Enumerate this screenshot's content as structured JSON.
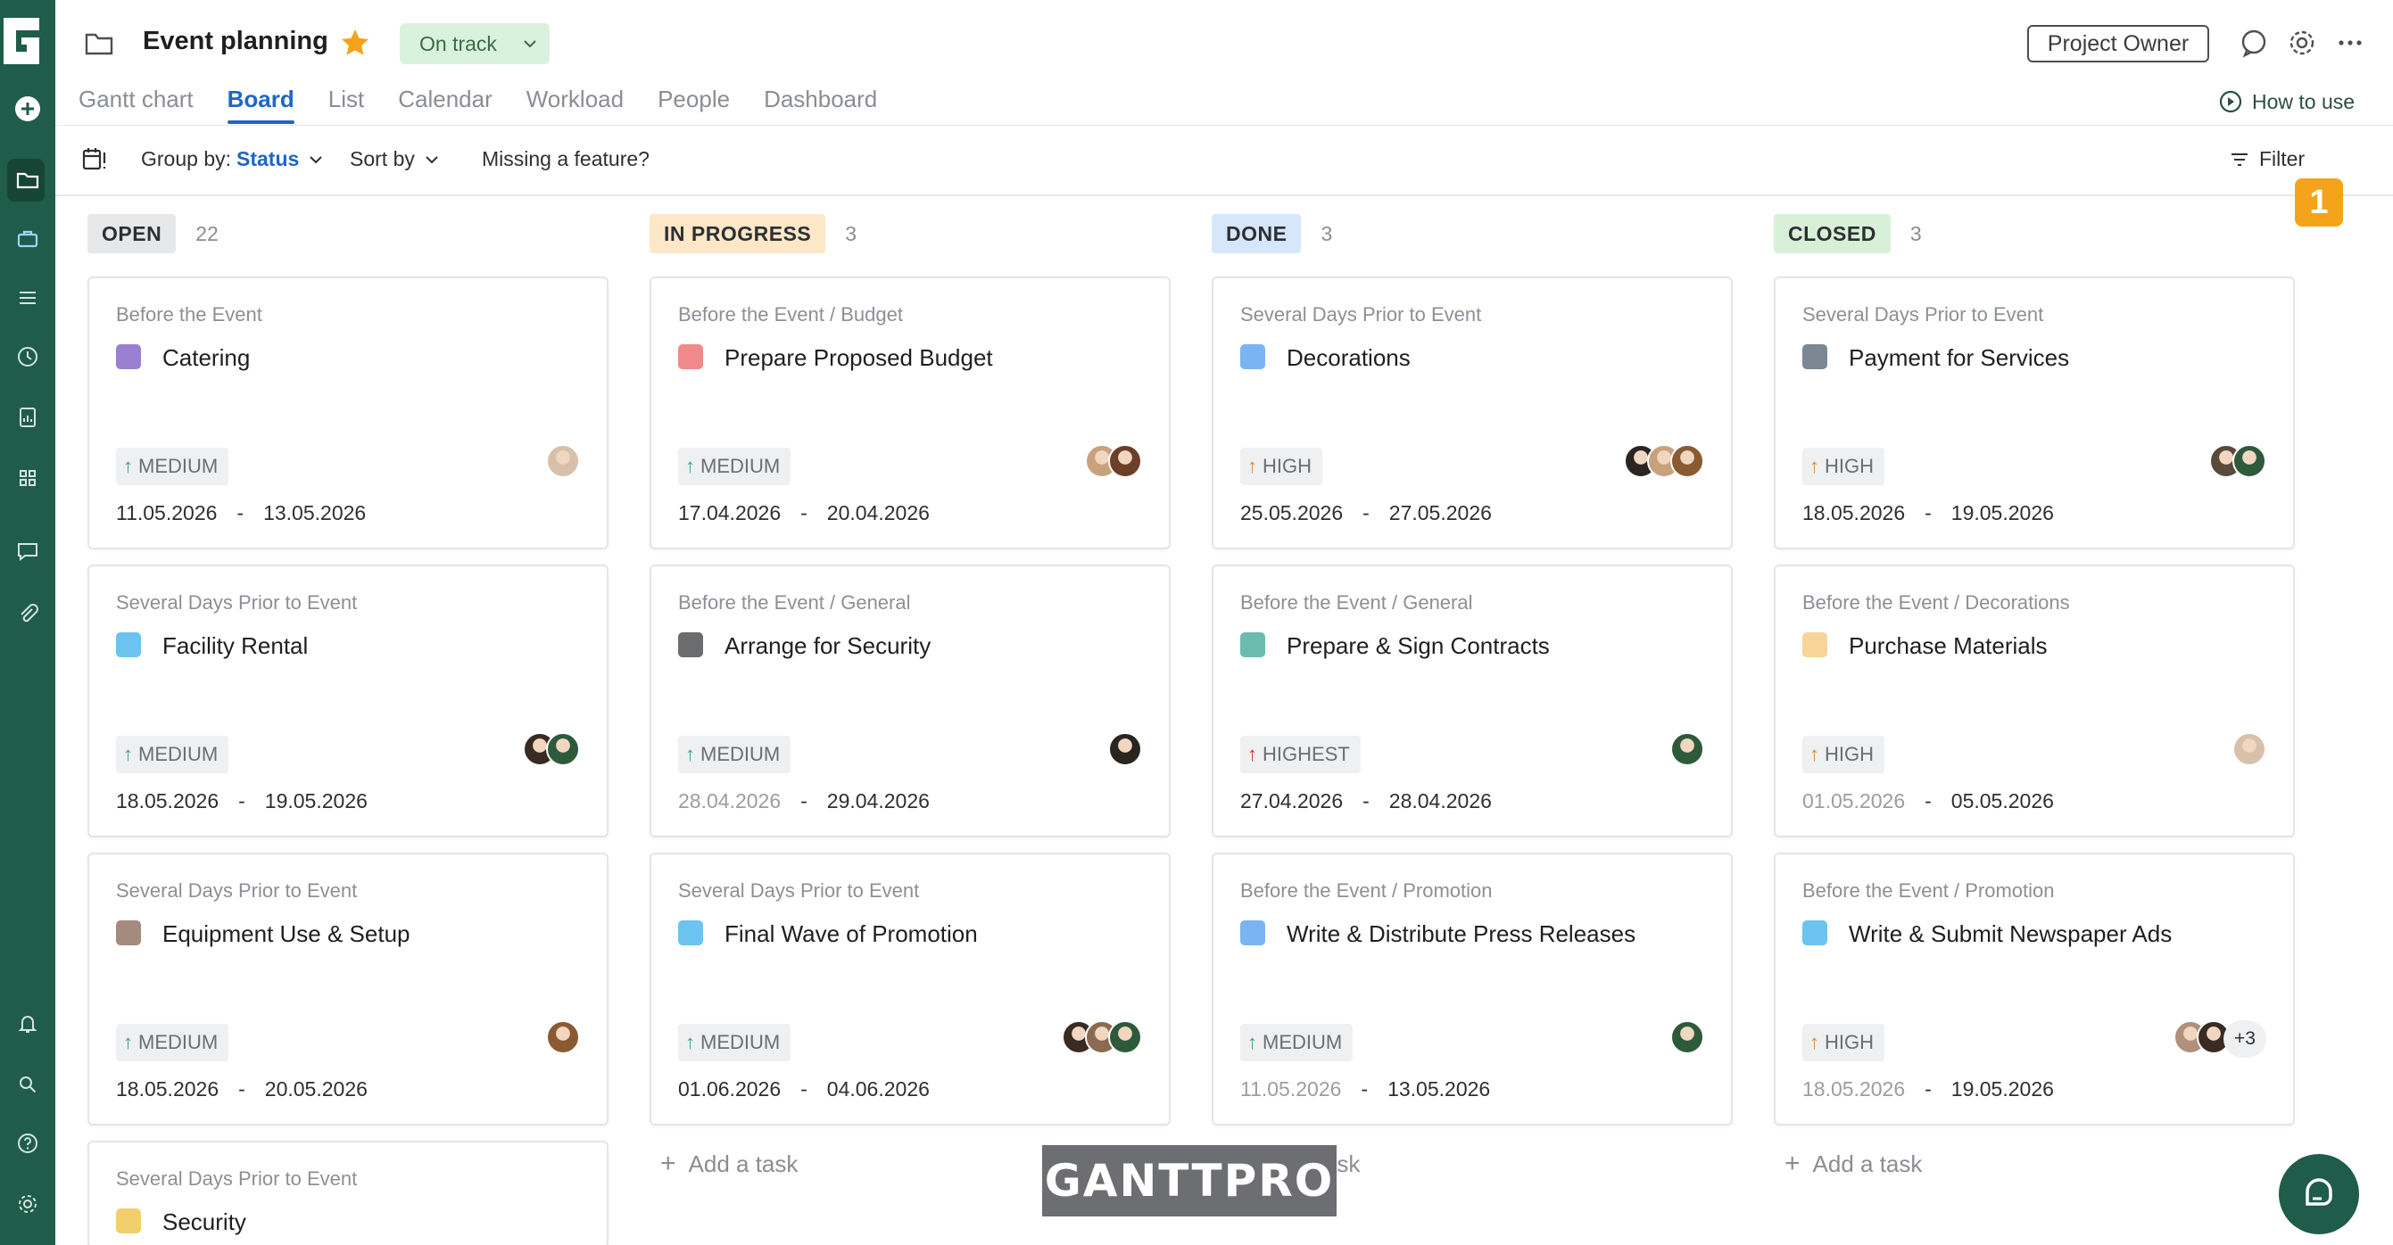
{
  "header": {
    "title": "Event planning",
    "status": "On track",
    "owner_button": "Project Owner",
    "how_to_use": "How to use"
  },
  "tabs": [
    {
      "label": "Gantt chart",
      "active": false
    },
    {
      "label": "Board",
      "active": true
    },
    {
      "label": "List",
      "active": false
    },
    {
      "label": "Calendar",
      "active": false
    },
    {
      "label": "Workload",
      "active": false
    },
    {
      "label": "People",
      "active": false
    },
    {
      "label": "Dashboard",
      "active": false
    }
  ],
  "toolbar": {
    "group_by_label": "Group by:",
    "group_by_value": "Status",
    "sort_by": "Sort by",
    "missing_feature": "Missing a feature?",
    "filter": "Filter"
  },
  "annotation_badge": "1",
  "columns": [
    {
      "label": "OPEN",
      "count": "22",
      "color": "#e6e7e9",
      "add_task": "",
      "cards": [
        {
          "path": "Before the Event",
          "name": "Catering",
          "color": "#9b7fd1",
          "priority": "MEDIUM",
          "start": "11.05.2026",
          "end": "13.05.2026",
          "start_dim": false
        },
        {
          "path": "Several Days Prior to Event",
          "name": "Facility Rental",
          "color": "#6cc3f0",
          "priority": "MEDIUM",
          "start": "18.05.2026",
          "end": "19.05.2026",
          "start_dim": false
        },
        {
          "path": "Several Days Prior to Event",
          "name": "Equipment Use & Setup",
          "color": "#a58a7e",
          "priority": "MEDIUM",
          "start": "18.05.2026",
          "end": "20.05.2026",
          "start_dim": false
        },
        {
          "path": "Several Days Prior to Event",
          "name": "Security",
          "color": "#f2cf6b",
          "priority": "",
          "start": "",
          "end": "",
          "start_dim": false
        }
      ]
    },
    {
      "label": "IN PROGRESS",
      "count": "3",
      "color": "#fde7c7",
      "add_task": "Add a task",
      "cards": [
        {
          "path": "Before the Event / Budget",
          "name": "Prepare Proposed Budget",
          "color": "#f08a8a",
          "priority": "MEDIUM",
          "start": "17.04.2026",
          "end": "20.04.2026",
          "start_dim": false
        },
        {
          "path": "Before the Event / General",
          "name": "Arrange for Security",
          "color": "#6b6c6e",
          "priority": "MEDIUM",
          "start": "28.04.2026",
          "end": "29.04.2026",
          "start_dim": true
        },
        {
          "path": "Several Days Prior to Event",
          "name": "Final Wave of Promotion",
          "color": "#6cc3f0",
          "priority": "MEDIUM",
          "start": "01.06.2026",
          "end": "04.06.2026",
          "start_dim": false
        }
      ]
    },
    {
      "label": "DONE",
      "count": "3",
      "color": "#d6e7fb",
      "add_task": "Add a task",
      "cards": [
        {
          "path": "Several Days Prior to Event",
          "name": "Decorations",
          "color": "#7ab4f3",
          "priority": "HIGH",
          "start": "25.05.2026",
          "end": "27.05.2026",
          "start_dim": false
        },
        {
          "path": "Before the Event / General",
          "name": "Prepare & Sign Contracts",
          "color": "#6cbcae",
          "priority": "HIGHEST",
          "start": "27.04.2026",
          "end": "28.04.2026",
          "start_dim": false
        },
        {
          "path": "Before the Event / Promotion",
          "name": "Write & Distribute Press Releases",
          "color": "#7ab4f3",
          "priority": "MEDIUM",
          "start": "11.05.2026",
          "end": "13.05.2026",
          "start_dim": true
        }
      ]
    },
    {
      "label": "CLOSED",
      "count": "3",
      "color": "#d8f0d8",
      "add_task": "Add a task",
      "cards": [
        {
          "path": "Several Days Prior to Event",
          "name": "Payment for Services",
          "color": "#7b8792",
          "priority": "HIGH",
          "start": "18.05.2026",
          "end": "19.05.2026",
          "start_dim": false
        },
        {
          "path": "Before the Event / Decorations",
          "name": "Purchase Materials",
          "color": "#f7d49a",
          "priority": "HIGH",
          "start": "01.05.2026",
          "end": "05.05.2026",
          "start_dim": true
        },
        {
          "path": "Before the Event / Promotion",
          "name": "Write & Submit Newspaper Ads",
          "color": "#6cc3f0",
          "priority": "HIGH",
          "start": "18.05.2026",
          "end": "19.05.2026",
          "start_dim": true
        }
      ]
    }
  ],
  "avatar_extra": "+3",
  "watermark": "GANTTPRO",
  "colors": {
    "sidebar": "#1f5c4a",
    "accent": "#1f66c9",
    "badge": "#f5a31a",
    "star": "#f5a31a"
  }
}
